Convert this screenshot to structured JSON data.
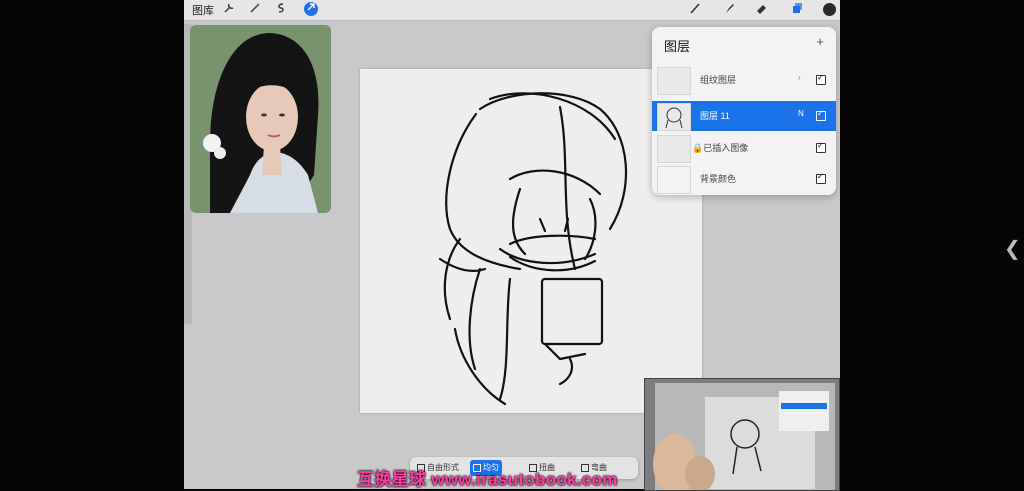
{
  "toolbar": {
    "gallery_label": "图库",
    "left_icons": [
      "wrench-icon",
      "magic-wand-icon",
      "selection-icon",
      "transform-arrow-icon"
    ],
    "right_icons": [
      "brush-icon",
      "smudge-icon",
      "eraser-icon",
      "layers-icon"
    ],
    "accent": "#1f6fe8"
  },
  "layers_panel": {
    "title": "图层",
    "add_button": "+",
    "rows": [
      {
        "name": "组纹图层",
        "mode": "›",
        "visible": true,
        "selected": false
      },
      {
        "name": "图层 11",
        "mode": "N",
        "visible": true,
        "selected": true
      },
      {
        "name": "已插入图像",
        "mode": "",
        "visible": true,
        "selected": false,
        "locked": true
      },
      {
        "name": "背景颜色",
        "mode": "",
        "visible": true,
        "selected": false
      }
    ]
  },
  "bottom_bar": {
    "buttons": [
      {
        "label": "自由形式",
        "active": false
      },
      {
        "label": "均匀",
        "active": true
      },
      {
        "label": "扭曲",
        "active": false
      },
      {
        "label": "弯曲",
        "active": false
      }
    ]
  },
  "watermark": "互换星球 www.irasutobook.com",
  "side_chevron": "❮"
}
